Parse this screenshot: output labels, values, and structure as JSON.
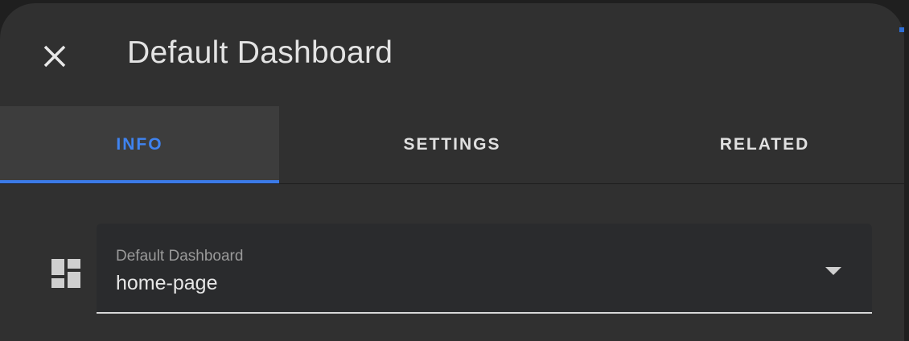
{
  "dialog": {
    "title": "Default Dashboard",
    "close_icon": "close-icon"
  },
  "tabs": [
    {
      "label": "INFO",
      "active": true
    },
    {
      "label": "SETTINGS",
      "active": false
    },
    {
      "label": "RELATED",
      "active": false
    }
  ],
  "field": {
    "icon": "view-dashboard-icon",
    "label": "Default Dashboard",
    "value": "home-page"
  },
  "colors": {
    "accent": "#3b7ae8",
    "background": "#303030"
  }
}
